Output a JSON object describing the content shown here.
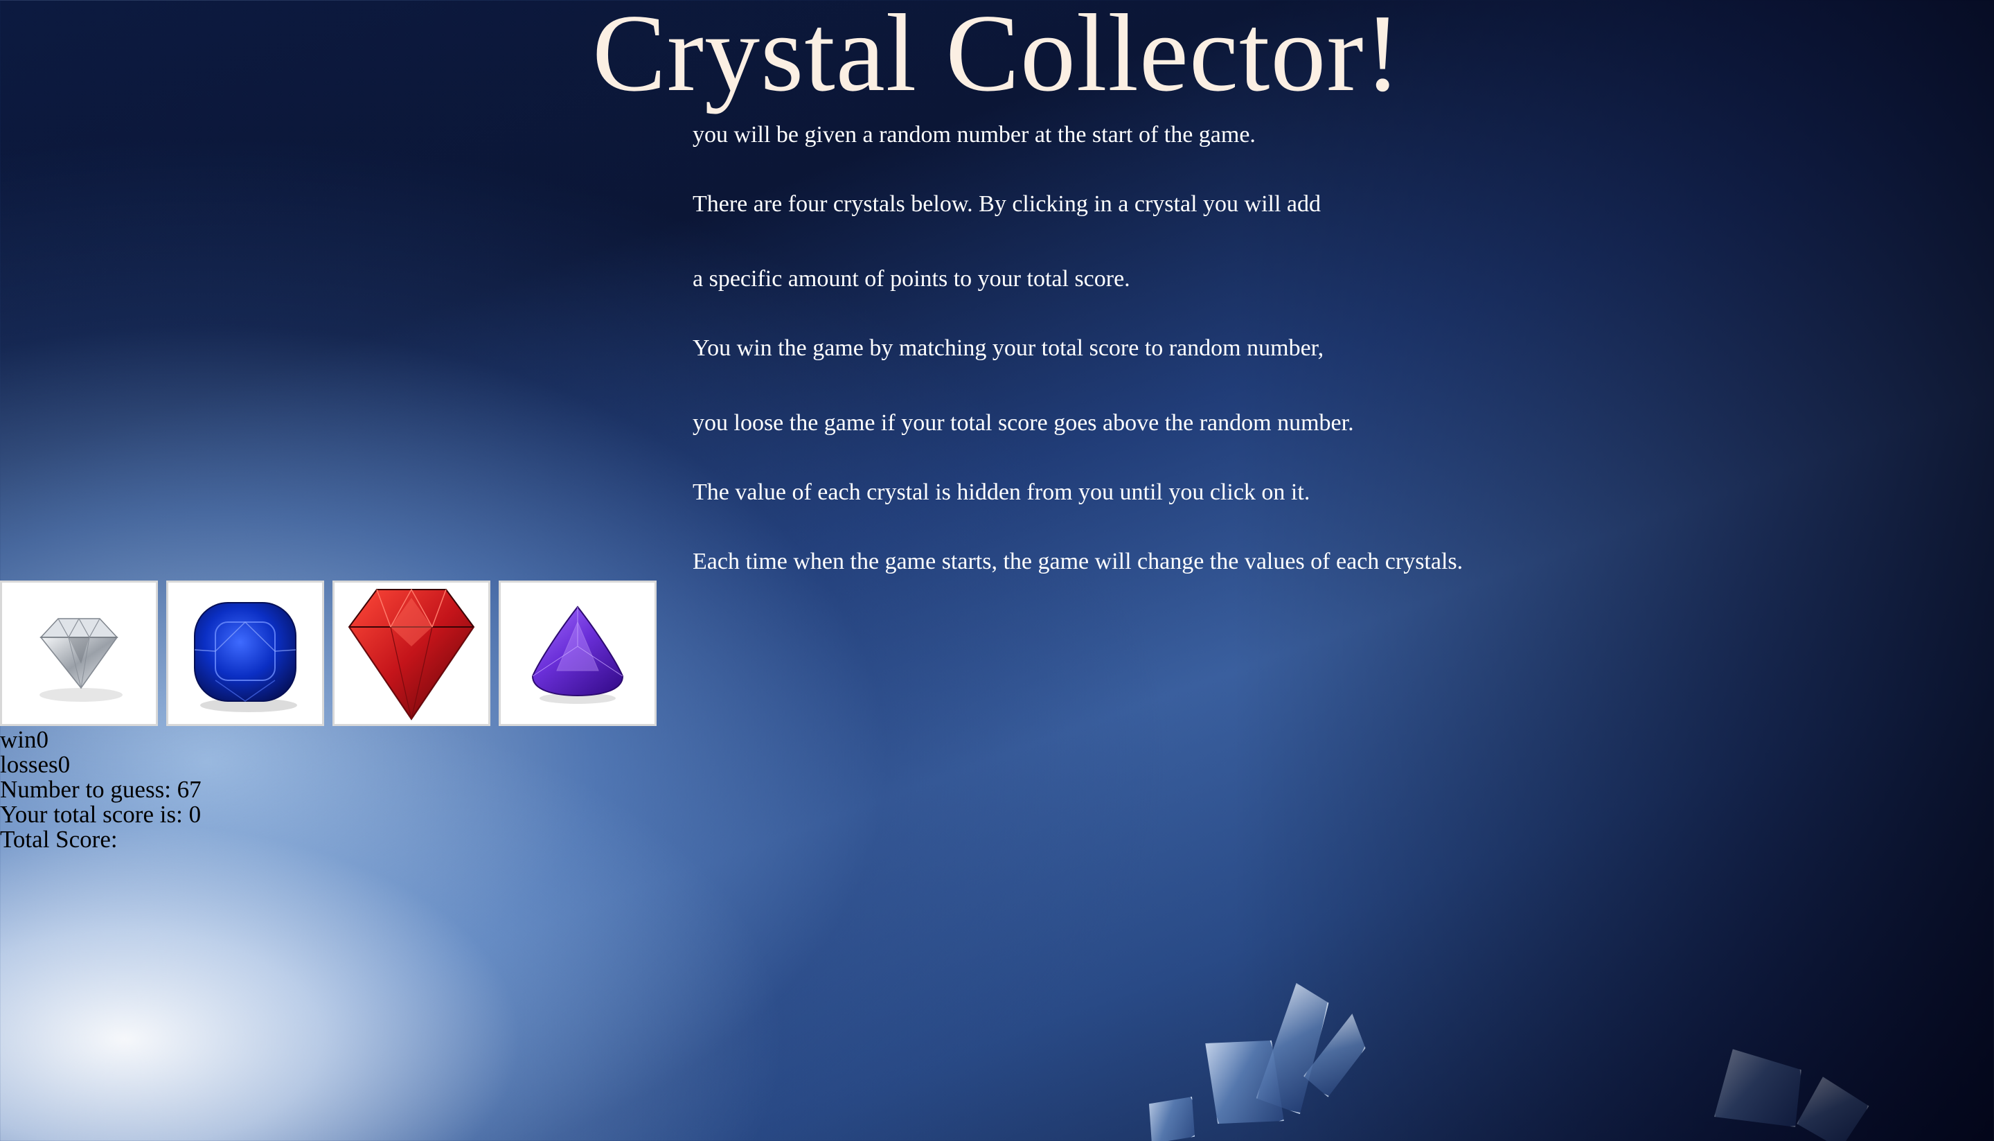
{
  "title": "Crystal Collector!",
  "instructions": [
    "you will be given a random number at the start of the game.",
    "There are four crystals below. By clicking in a crystal you will add",
    "a specific amount of points to your total score.",
    "You win the game by matching your total score to random number,",
    "you loose the game if your total score goes above the random number.",
    "The value of each crystal is hidden from you until you click on it.",
    "Each time when the game starts, the game will change the values of each crystals."
  ],
  "crystals": [
    {
      "icon": "clear-diamond-icon",
      "color": "#d9dde3"
    },
    {
      "icon": "blue-sapphire-icon",
      "color": "#0b2fc4"
    },
    {
      "icon": "red-ruby-icon",
      "color": "#c4141a"
    },
    {
      "icon": "purple-amethyst-icon",
      "color": "#6a2fd8"
    }
  ],
  "stats": {
    "wins_label": "win",
    "wins_value": "0",
    "losses_label": "losses",
    "losses_value": "0",
    "target_label": "Number to guess: ",
    "target_value": "67",
    "score_label": "Your total score is: ",
    "score_value": "0",
    "total_score_label": "Total Score:"
  }
}
